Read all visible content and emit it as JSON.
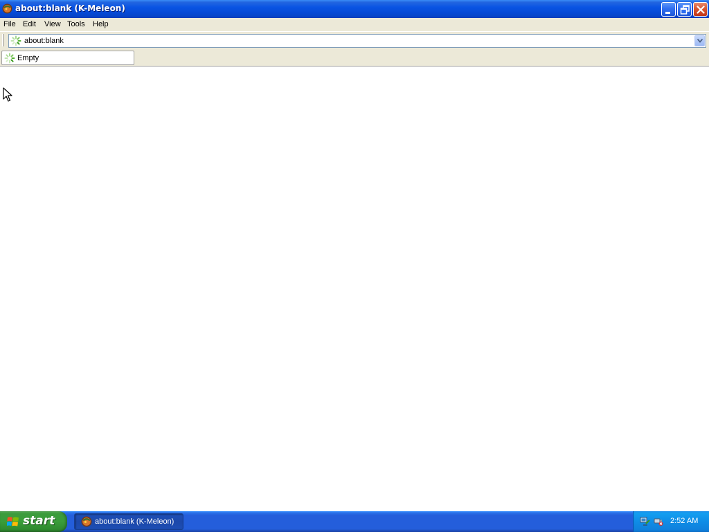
{
  "window": {
    "title": "about:blank (K-Meleon)"
  },
  "menu": {
    "items": [
      "File",
      "Edit",
      "View",
      "Tools",
      "Help"
    ]
  },
  "address": {
    "value": "about:blank"
  },
  "tabs": [
    {
      "label": "Empty"
    }
  ],
  "taskbar": {
    "start_label": "start",
    "task_item_label": "about:blank (K-Meleon)",
    "clock": "2:52 AM"
  },
  "colors": {
    "titlebar_blue": "#0a54e3",
    "taskbar_blue": "#245edb",
    "start_green": "#3a9d3a",
    "chrome_beige": "#ece9d8"
  },
  "icons": [
    "k-meleon-icon",
    "minimize-icon",
    "restore-icon",
    "close-icon",
    "loading-icon",
    "dropdown-arrow-icon",
    "windows-logo-icon",
    "network-icon",
    "safely-remove-icon",
    "mouse-cursor-icon"
  ]
}
